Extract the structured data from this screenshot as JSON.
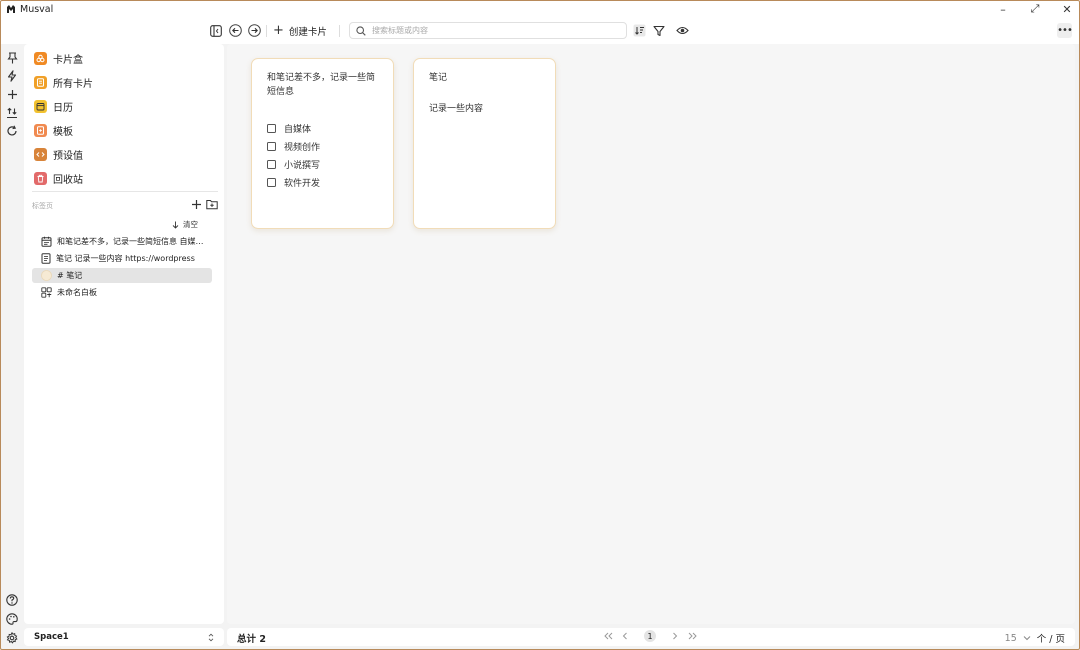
{
  "window": {
    "app_title": "Musval",
    "minimize_glyph": "–",
    "maximize_glyph": "⤢",
    "close_glyph": "✕"
  },
  "toolbar": {
    "create_card_label": "创建卡片",
    "search_placeholder": "搜索标题或内容"
  },
  "sidebar": {
    "nav": [
      {
        "label": "卡片盒",
        "icon": "cards-box-icon",
        "color": "#f08a24"
      },
      {
        "label": "所有卡片",
        "icon": "all-cards-icon",
        "color": "#f0a028"
      },
      {
        "label": "日历",
        "icon": "calendar-icon",
        "color": "#f2c230"
      },
      {
        "label": "模板",
        "icon": "template-icon",
        "color": "#f08a50"
      },
      {
        "label": "预设值",
        "icon": "preset-icon",
        "color": "#d8843a"
      },
      {
        "label": "回收站",
        "icon": "trash-icon",
        "color": "#e26a6a"
      }
    ],
    "tabs_section_label": "标签页",
    "clear_label": "清空",
    "tabs": [
      {
        "label": "和笔记差不多，记录一些简短信息 自媒体 视频创作 小说撰写 软件开发",
        "icon": "calendar-note-icon"
      },
      {
        "label": "笔记 记录一些内容 https://wordpress",
        "icon": "document-icon"
      },
      {
        "label": "# 笔记",
        "icon": "tag-icon"
      },
      {
        "label": "未命名白板",
        "icon": "whiteboard-icon"
      }
    ],
    "active_tab": 2
  },
  "space": {
    "name": "Space1"
  },
  "cards": [
    {
      "title": "和笔记差不多，记录一些简短信息",
      "checklist": [
        "自媒体",
        "视频创作",
        "小说撰写",
        "软件开发"
      ]
    },
    {
      "title": "笔记",
      "content": "记录一些内容"
    }
  ],
  "footer": {
    "total_label": "总计",
    "total_count": "2",
    "current_page": "1",
    "page_size": "15",
    "page_size_unit": "个 / 页"
  },
  "colors": {
    "accent": "#f08a24",
    "card_border": "#f1dcb8",
    "window_border": "#b88a5a"
  }
}
